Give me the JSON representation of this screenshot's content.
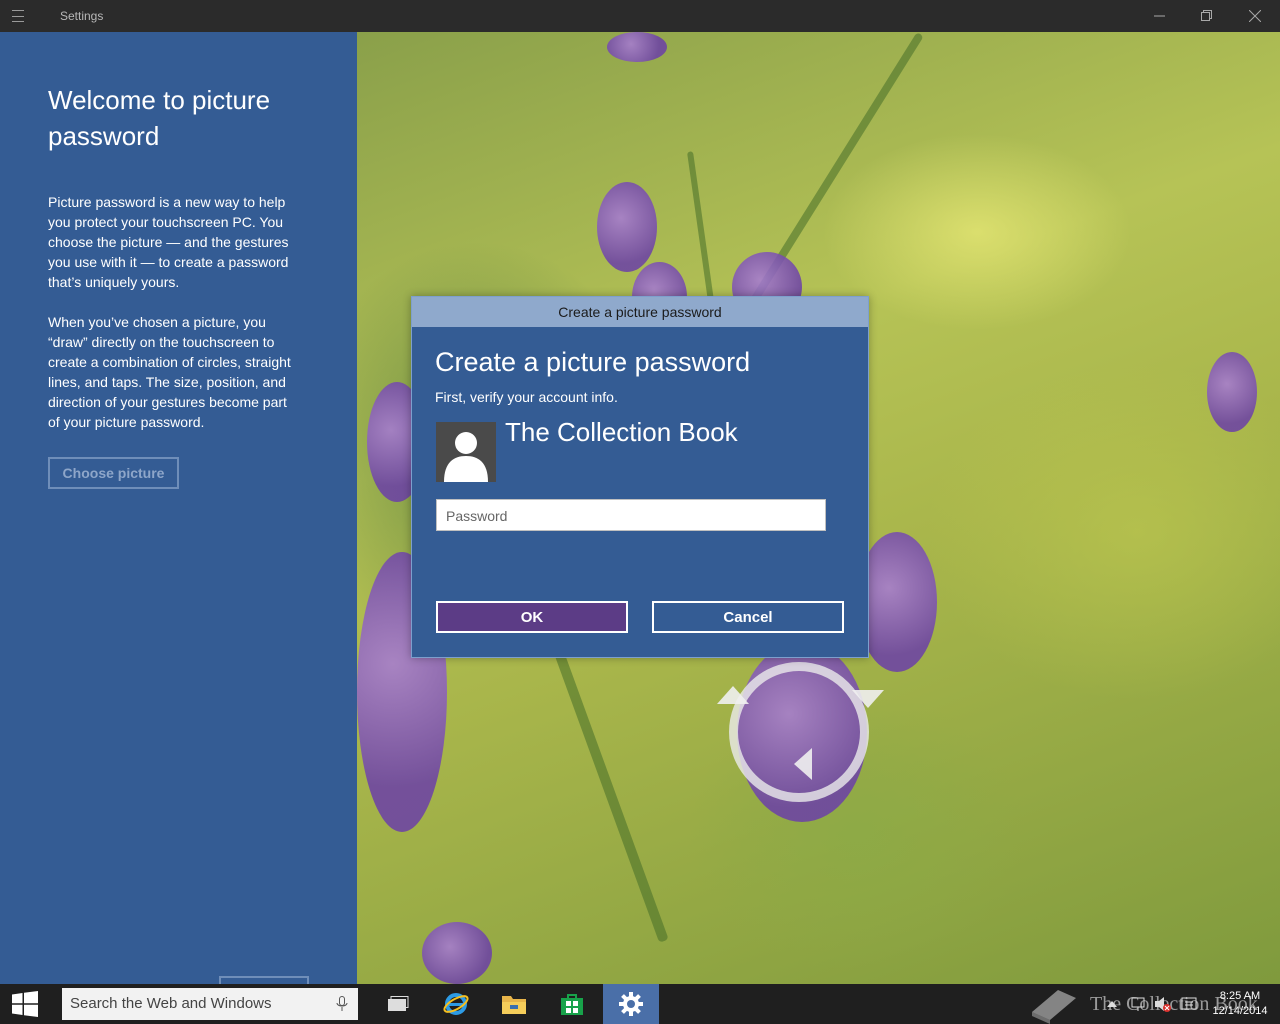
{
  "window": {
    "title": "Settings"
  },
  "left_pane": {
    "heading": "Welcome to picture password",
    "paragraph1": "Picture password is a new way to help you protect your touchscreen PC. You choose the picture — and the gestures you use with it — to create a password that’s uniquely yours.",
    "paragraph2": "When you’ve chosen a picture, you “draw” directly on the touchscreen to create a combination of circles, straight lines, and taps. The size, position, and direction of your gestures become part of your picture password.",
    "choose_button": "Choose picture"
  },
  "dialog": {
    "titlebar": "Create a picture password",
    "heading": "Create a picture password",
    "subtitle": "First, verify your account info.",
    "user_name": "The Collection Book",
    "password_placeholder": "Password",
    "password_value": "",
    "ok_label": "OK",
    "cancel_label": "Cancel"
  },
  "taskbar": {
    "search_placeholder": "Search the Web and Windows",
    "pinned": [
      "task-view-icon",
      "internet-explorer-icon",
      "file-explorer-icon",
      "store-icon",
      "settings-icon"
    ],
    "active": "settings-icon",
    "clock_time": "8:25 AM",
    "clock_date": "12/14/2014"
  },
  "watermark": {
    "text": "The Collection Book"
  },
  "colors": {
    "accent_blue": "#345c94",
    "dialog_title": "#8fa9cc",
    "ok_purple": "#5c3c86",
    "taskbar": "#1f1f1f"
  }
}
